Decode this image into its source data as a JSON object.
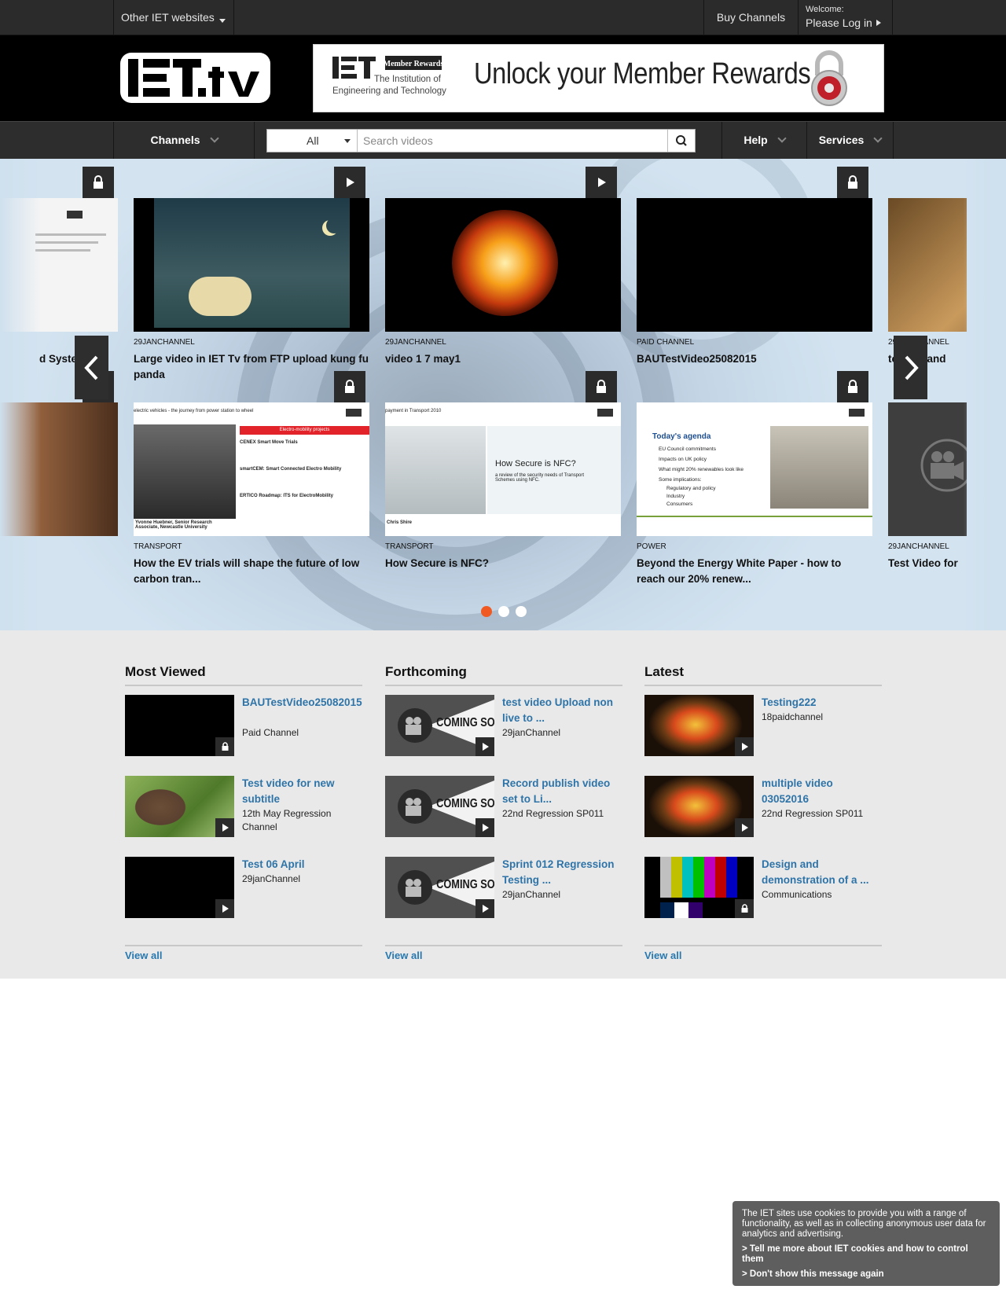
{
  "topbar": {
    "other_sites": "Other IET websites",
    "buy_channels": "Buy Channels",
    "welcome": "Welcome:",
    "login": "Please Log in"
  },
  "header": {
    "logo_alt": "IET.tv",
    "banner": {
      "badge": "Member Rewards",
      "org_line1": "The Institution of",
      "org_line2": "Engineering and Technology",
      "headline": "Unlock your Member Rewards"
    }
  },
  "nav": {
    "channels": "Channels",
    "search_category": "All",
    "search_placeholder": "Search videos",
    "help": "Help",
    "services": "Services"
  },
  "carousel": {
    "row1": [
      {
        "channel": "",
        "title": "d Syste",
        "access": "locked"
      },
      {
        "channel": "29JANCHANNEL",
        "title": "Large video in IET Tv from FTP upload kung fu panda",
        "access": "free"
      },
      {
        "channel": "29JANCHANNEL",
        "title": "video 1 7 may1",
        "access": "free"
      },
      {
        "channel": "PAID CHANNEL",
        "title": "BAUTestVideo25082015",
        "access": "locked"
      },
      {
        "channel": "29JANCHANNEL",
        "title": "to view and",
        "access": "free"
      }
    ],
    "row2": [
      {
        "channel": "",
        "title": "",
        "access": "free"
      },
      {
        "channel": "TRANSPORT",
        "title": "How the EV trials will shape the future of low carbon tran...",
        "access": "locked"
      },
      {
        "channel": "TRANSPORT",
        "title": "How Secure is NFC?",
        "access": "locked"
      },
      {
        "channel": "POWER",
        "title": "Beyond the Energy White Paper - how to reach our 20% renew...",
        "access": "locked"
      },
      {
        "channel": "29JANCHANNEL",
        "title": "Test Video for",
        "access": "free"
      }
    ],
    "slides": {
      "ev_heading": "Electro-mobility projects",
      "ev_items": [
        "CENEX Smart Move Trials",
        "smartCEM: Smart Connected Electro Mobility",
        "ERTICO Roadmap: ITS for ElectroMobility"
      ],
      "ev_caption": "Yvonne Huebner, Senior Research Associate, Newcastle University",
      "ev_top": "electric vehicles - the journey from power station to wheel",
      "nfc_top": "payment in Transport 2010",
      "nfc_heading": "How Secure is NFC?",
      "nfc_sub": "a review of the security needs of Transport Schemes using NFC.",
      "nfc_caption": "Chris Shire",
      "power_heading": "Today's agenda",
      "power_items": [
        "EU Council commitments",
        "Impacts on UK policy",
        "What might 20% renewables look like",
        "Some implications:",
        "Regulatory and policy",
        "Industry",
        "Consumers"
      ]
    },
    "active_page": 1,
    "page_count": 3
  },
  "lists": {
    "most_viewed": {
      "heading": "Most Viewed",
      "items": [
        {
          "title": "BAUTestVideo25082015",
          "subtitle": "Paid Channel",
          "access": "locked"
        },
        {
          "title": "Test video for new subtitle",
          "subtitle": "12th May Regression Channel",
          "access": "free"
        },
        {
          "title": "Test 06 April",
          "subtitle": "29janChannel",
          "access": "free"
        }
      ],
      "view_all": "View all"
    },
    "forthcoming": {
      "heading": "Forthcoming",
      "items": [
        {
          "title": "test video Upload non live to ...",
          "subtitle": "29janChannel",
          "access": "free"
        },
        {
          "title": "Record publish video set to Li...",
          "subtitle": "22nd Regression SP011",
          "access": "free"
        },
        {
          "title": "Sprint 012 Regression Testing ...",
          "subtitle": "29janChannel",
          "access": "free"
        }
      ],
      "view_all": "View all",
      "coming_soon": "COMING SOON"
    },
    "latest": {
      "heading": "Latest",
      "items": [
        {
          "title": "Testing222",
          "subtitle": "18paidchannel",
          "access": "free"
        },
        {
          "title": "multiple video 03052016",
          "subtitle": "22nd Regression SP011",
          "access": "free"
        },
        {
          "title": "Design and demonstration of a ...",
          "subtitle": "Communications",
          "access": "locked"
        }
      ],
      "view_all": "View all"
    }
  },
  "cookie": {
    "message": "The IET sites use cookies to provide you with a range of functionality, as well as in collecting anonymous user data for analytics and advertising.",
    "more_link": "> Tell me more about IET cookies and how to control them",
    "dismiss_link": "> Don't show this message again"
  },
  "colors": {
    "accent_orange": "#f05a22",
    "link_blue": "#2e74a8",
    "dark_bar": "#2b2b2b"
  }
}
